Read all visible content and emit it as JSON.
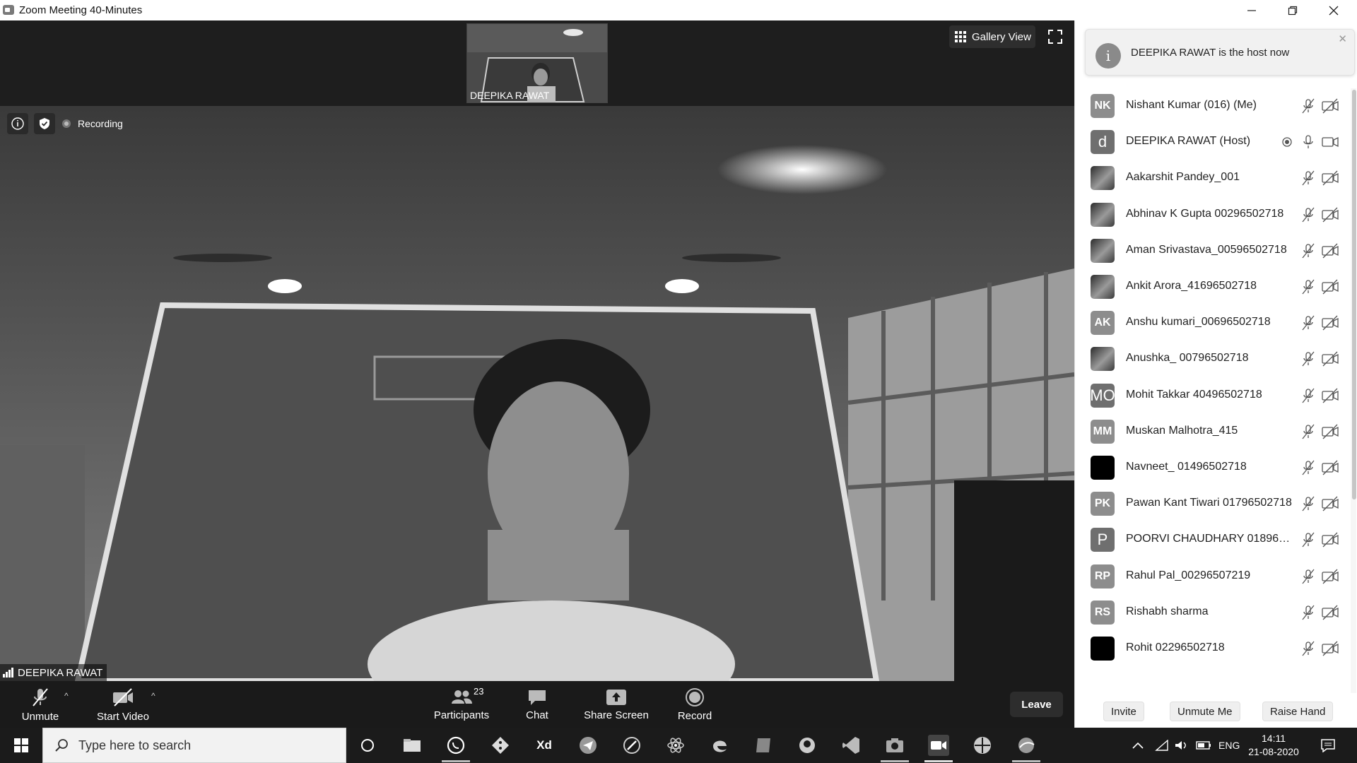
{
  "window": {
    "title": "Zoom Meeting 40-Minutes"
  },
  "meeting": {
    "thumbnail_name": "DEEPIKA RAWAT",
    "gallery_view_label": "Gallery View",
    "recording_label": "Recording",
    "speaker_name": "DEEPIKA RAWAT"
  },
  "toolbar": {
    "unmute_label": "Unmute",
    "start_video_label": "Start Video",
    "participants_label": "Participants",
    "participants_count": "23",
    "chat_label": "Chat",
    "share_screen_label": "Share Screen",
    "record_label": "Record",
    "leave_label": "Leave"
  },
  "panel": {
    "notice_text": "DEEPIKA RAWAT is the host now",
    "participants": [
      {
        "initials": "NK",
        "name": "Nishant Kumar (016) (Me)",
        "avatar": "initials",
        "muted": true,
        "video_off": true
      },
      {
        "initials": "d",
        "name": "DEEPIKA RAWAT (Host)",
        "avatar": "letter",
        "muted": false,
        "video_off": false,
        "recording": true
      },
      {
        "initials": "",
        "name": "Aakarshit Pandey_001",
        "avatar": "photo",
        "muted": true,
        "video_off": true
      },
      {
        "initials": "",
        "name": "Abhinav K Gupta 00296502718",
        "avatar": "photo",
        "muted": true,
        "video_off": true
      },
      {
        "initials": "",
        "name": "Aman Srivastava_00596502718",
        "avatar": "photo",
        "muted": true,
        "video_off": true
      },
      {
        "initials": "",
        "name": "Ankit Arora_41696502718",
        "avatar": "photo",
        "muted": true,
        "video_off": true
      },
      {
        "initials": "AK",
        "name": "Anshu kumari_00696502718",
        "avatar": "initials",
        "muted": true,
        "video_off": true
      },
      {
        "initials": "",
        "name": "Anushka_ 00796502718",
        "avatar": "photo",
        "muted": true,
        "video_off": true
      },
      {
        "initials": "MO",
        "name": "Mohit Takkar 40496502718",
        "avatar": "letter",
        "muted": true,
        "video_off": true
      },
      {
        "initials": "MM",
        "name": "Muskan Malhotra_415",
        "avatar": "initials",
        "muted": true,
        "video_off": true
      },
      {
        "initials": "",
        "name": "Navneet_ 01496502718",
        "avatar": "dark",
        "muted": true,
        "video_off": true
      },
      {
        "initials": "PK",
        "name": "Pawan Kant Tiwari 01796502718",
        "avatar": "initials",
        "muted": true,
        "video_off": true
      },
      {
        "initials": "P",
        "name": "POORVI CHAUDHARY 01896502...",
        "avatar": "letter",
        "muted": true,
        "video_off": true
      },
      {
        "initials": "RP",
        "name": "Rahul Pal_00296507219",
        "avatar": "initials",
        "muted": true,
        "video_off": true
      },
      {
        "initials": "RS",
        "name": "Rishabh sharma",
        "avatar": "initials",
        "muted": true,
        "video_off": true
      },
      {
        "initials": "",
        "name": "Rohit 02296502718",
        "avatar": "dark",
        "muted": true,
        "video_off": true
      }
    ],
    "invite_label": "Invite",
    "unmute_me_label": "Unmute Me",
    "raise_hand_label": "Raise Hand"
  },
  "taskbar": {
    "search_placeholder": "Type here to search",
    "language": "ENG",
    "time": "14:11",
    "date": "21-08-2020"
  }
}
